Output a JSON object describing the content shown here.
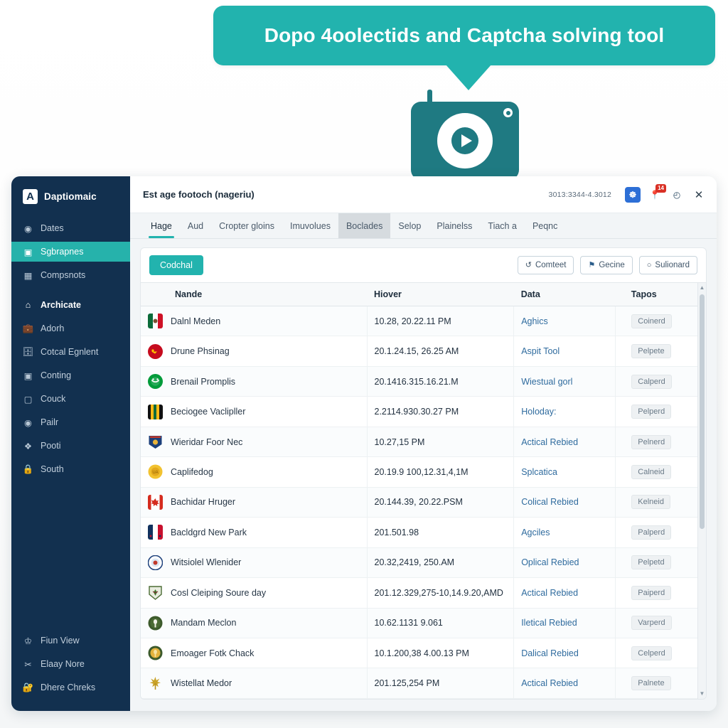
{
  "callout": {
    "text": "Dopo 4oolectids and Captcha solving tool"
  },
  "media": {
    "icon": "monitor-play-icon",
    "accent": "#1f7a82"
  },
  "sidebar": {
    "brand": {
      "mark": "A",
      "name": "Daptiomaic"
    },
    "items": [
      {
        "label": "Dates",
        "icon": "disc-icon",
        "active": false,
        "section": false
      },
      {
        "label": "Sgbrapnes",
        "icon": "id-card-icon",
        "active": true,
        "section": false
      },
      {
        "label": "Compsnots",
        "icon": "box-icon",
        "active": false,
        "section": false
      },
      {
        "label": "Archicate",
        "icon": "home-icon",
        "active": false,
        "section": true
      },
      {
        "label": "Adorh",
        "icon": "briefcase-icon",
        "active": false,
        "section": false
      },
      {
        "label": "Cotcal Egnlent",
        "icon": "case-icon",
        "active": false,
        "section": false
      },
      {
        "label": "Conting",
        "icon": "image-icon",
        "active": false,
        "section": false
      },
      {
        "label": "Couck",
        "icon": "tag-icon",
        "active": false,
        "section": false
      },
      {
        "label": "Pailr",
        "icon": "eye-icon",
        "active": false,
        "section": false
      },
      {
        "label": "Pooti",
        "icon": "puzzle-icon",
        "active": false,
        "section": false
      },
      {
        "label": "South",
        "icon": "lock-icon",
        "active": false,
        "section": false
      }
    ],
    "bottom_items": [
      {
        "label": "Fiun View",
        "icon": "person-icon"
      },
      {
        "label": "Elaay Nore",
        "icon": "scissors-icon"
      },
      {
        "label": "Dhere Chreks",
        "icon": "shield-lock-icon"
      }
    ]
  },
  "titlebar": {
    "title": "Est age footoch (nageriu)",
    "version": "3013:3344-4.3012",
    "buttons": [
      {
        "name": "account-icon",
        "glyph": "\u0001",
        "style": "blue"
      },
      {
        "name": "pin-icon",
        "glyph": "⚑",
        "style": "pin",
        "badge": "14"
      },
      {
        "name": "clock-icon",
        "glyph": "◷",
        "style": "plain"
      },
      {
        "name": "close-icon",
        "glyph": "✕",
        "style": "close"
      }
    ]
  },
  "tabs": [
    {
      "label": "Hage",
      "active": true,
      "highlight": false
    },
    {
      "label": "Aud",
      "active": false,
      "highlight": false
    },
    {
      "label": "Cropter gloins",
      "active": false,
      "highlight": false
    },
    {
      "label": "Imuvolues",
      "active": false,
      "highlight": false
    },
    {
      "label": "Boclades",
      "active": false,
      "highlight": true
    },
    {
      "label": "Selop",
      "active": false,
      "highlight": false
    },
    {
      "label": "Plainelss",
      "active": false,
      "highlight": false
    },
    {
      "label": "Tiach a",
      "active": false,
      "highlight": false
    },
    {
      "label": "Peqnc",
      "active": false,
      "highlight": false
    }
  ],
  "toolbar": {
    "primary_label": "Codchal",
    "actions": [
      {
        "label": "Comteet",
        "icon": "rotate-icon",
        "glyph": "↻"
      },
      {
        "label": "Gecine",
        "icon": "flag-icon",
        "glyph": "⚑"
      },
      {
        "label": "Sulionard",
        "icon": "circle-icon",
        "glyph": "○"
      }
    ]
  },
  "table": {
    "columns": [
      "Nande",
      "Hiover",
      "Data",
      "Tapos"
    ],
    "rows": [
      {
        "flag": "mexico-flag-icon",
        "name": "Dalnl Meden",
        "hover": "10.28, 20.22.11 PM",
        "data": "Aghics",
        "tag": "Coinerd"
      },
      {
        "flag": "spain-badge-icon",
        "name": "Drune Phsinag",
        "hover": "20.1.24.15,  26.25 AM",
        "data": "Aspit Tool",
        "tag": "Pelpete"
      },
      {
        "flag": "brazil-badge-icon",
        "name": "Brenail Promplis",
        "hover": "20.1416.315.16.21.M",
        "data": "Wiestual gorl",
        "tag": "Calperd"
      },
      {
        "flag": "jamaica-flag-icon",
        "name": "Beciogee Vaclipller",
        "hover": "2.2114.930.30.27 PM",
        "data": "Holoday:",
        "tag": "Pelperd"
      },
      {
        "flag": "crest-blue-icon",
        "name": "Wieridar Foor Nec",
        "hover": "10.27,15 PM",
        "data": "Actical Rebied",
        "tag": "Pelnerd"
      },
      {
        "flag": "gold-badge-icon",
        "name": "Caplifedog",
        "hover": "20.19.9 100,12.31,4,1M",
        "data": "Splcatica",
        "tag": "Calneid"
      },
      {
        "flag": "canada-flag-icon",
        "name": "Bachidar Hruger",
        "hover": "20.144.39, 20.22.PSM",
        "data": "Colical Rebied",
        "tag": "Kelneid"
      },
      {
        "flag": "france-flag-icon",
        "name": "Bacldgrd New Park",
        "hover": "201.501.98",
        "data": "Agciles",
        "tag": "Palperd"
      },
      {
        "flag": "round-seal-icon",
        "name": "Witsiolel Wlenider",
        "hover": "20.32,2419, 250.AM",
        "data": "Oplical Rebied",
        "tag": "Pelpetd"
      },
      {
        "flag": "green-crest-icon",
        "name": "Cosl Cleiping Soure day",
        "hover": "201.12.329,275-10,14.9.20,AMD",
        "data": "Actical Rebied",
        "tag": "Paiperd"
      },
      {
        "flag": "olive-medal-icon",
        "name": "Mandam Meclon",
        "hover": "10.62.1131 9.061",
        "data": "Iletical Rebied",
        "tag": "Varperd"
      },
      {
        "flag": "gold-medal-icon",
        "name": "Emoager Fotk Chack",
        "hover": "10.1.200,38 4.00.13 PM",
        "data": "Dalical Rebied",
        "tag": "Celperd"
      },
      {
        "flag": "sword-crest-icon",
        "name": "Wistellat Medor",
        "hover": "201.125,254 PM",
        "data": "Actical Rebied",
        "tag": "Palnete"
      }
    ]
  },
  "colors": {
    "accent_teal": "#22b3ae",
    "sidebar_navy": "#12304f",
    "media_teal": "#1f7a82",
    "link_blue": "#2f6b9e"
  }
}
